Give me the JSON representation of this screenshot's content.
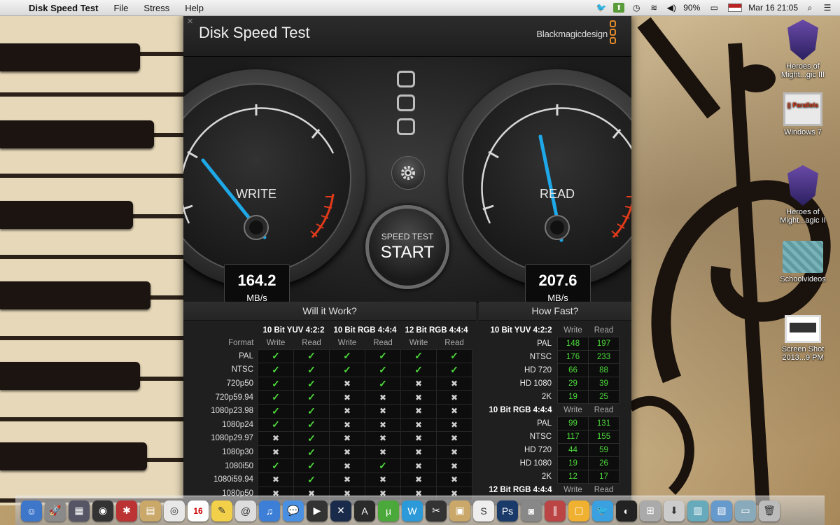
{
  "menubar": {
    "app_name": "Disk Speed Test",
    "items": [
      "File",
      "Stress",
      "Help"
    ],
    "battery": "90%",
    "datetime": "Mar 16  21:05"
  },
  "window": {
    "title": "Disk Speed Test",
    "brand": "Blackmagicdesign"
  },
  "gauges": {
    "write": {
      "label": "WRITE",
      "value": "164.2",
      "unit": "MB/s"
    },
    "read": {
      "label": "READ",
      "value": "207.6",
      "unit": "MB/s"
    }
  },
  "start_button": {
    "top": "SPEED TEST",
    "main": "START"
  },
  "will_it_work": {
    "title": "Will it Work?",
    "format_label": "Format",
    "groups": [
      "10 Bit YUV 4:2:2",
      "10 Bit RGB 4:4:4",
      "12 Bit RGB 4:4:4"
    ],
    "sub": [
      "Write",
      "Read",
      "Write",
      "Read",
      "Write",
      "Read"
    ],
    "rows": [
      {
        "format": "PAL",
        "cells": [
          1,
          1,
          1,
          1,
          1,
          1
        ]
      },
      {
        "format": "NTSC",
        "cells": [
          1,
          1,
          1,
          1,
          1,
          1
        ]
      },
      {
        "format": "720p50",
        "cells": [
          1,
          1,
          0,
          1,
          0,
          0
        ]
      },
      {
        "format": "720p59.94",
        "cells": [
          1,
          1,
          0,
          0,
          0,
          0
        ]
      },
      {
        "format": "1080p23.98",
        "cells": [
          1,
          1,
          0,
          0,
          0,
          0
        ]
      },
      {
        "format": "1080p24",
        "cells": [
          1,
          1,
          0,
          0,
          0,
          0
        ]
      },
      {
        "format": "1080p29.97",
        "cells": [
          0,
          1,
          0,
          0,
          0,
          0
        ]
      },
      {
        "format": "1080p30",
        "cells": [
          0,
          1,
          0,
          0,
          0,
          0
        ]
      },
      {
        "format": "1080i50",
        "cells": [
          1,
          1,
          0,
          1,
          0,
          0
        ]
      },
      {
        "format": "1080i59.94",
        "cells": [
          0,
          1,
          0,
          0,
          0,
          0
        ]
      },
      {
        "format": "1080p50",
        "cells": [
          0,
          0,
          0,
          0,
          0,
          0
        ]
      }
    ]
  },
  "how_fast": {
    "title": "How Fast?",
    "col_write": "Write",
    "col_read": "Read",
    "groups": [
      {
        "name": "10 Bit YUV 4:2:2",
        "rows": [
          {
            "label": "PAL",
            "write": "148",
            "read": "197"
          },
          {
            "label": "NTSC",
            "write": "176",
            "read": "233"
          },
          {
            "label": "HD 720",
            "write": "66",
            "read": "88"
          },
          {
            "label": "HD 1080",
            "write": "29",
            "read": "39"
          },
          {
            "label": "2K",
            "write": "19",
            "read": "25"
          }
        ]
      },
      {
        "name": "10 Bit RGB 4:4:4",
        "rows": [
          {
            "label": "PAL",
            "write": "99",
            "read": "131"
          },
          {
            "label": "NTSC",
            "write": "117",
            "read": "155"
          },
          {
            "label": "HD 720",
            "write": "44",
            "read": "59"
          },
          {
            "label": "HD 1080",
            "write": "19",
            "read": "26"
          },
          {
            "label": "2K",
            "write": "12",
            "read": "17"
          }
        ]
      },
      {
        "name": "12 Bit RGB 4:4:4",
        "rows": []
      }
    ]
  },
  "desktop_icons": [
    {
      "label": "Heroes of Might...gic III",
      "icon": "shield-icon"
    },
    {
      "label": "Windows 7",
      "icon": "parallels-icon"
    },
    {
      "label": "Heroes of Might...agic II",
      "icon": "shield-icon"
    },
    {
      "label": "Schoolvideos",
      "icon": "folder-icon"
    },
    {
      "label": "Screen Shot 2013...9 PM",
      "icon": "screenshot-icon"
    }
  ],
  "parallels_text": "|| Parallels",
  "dock_calendar_day": "16"
}
